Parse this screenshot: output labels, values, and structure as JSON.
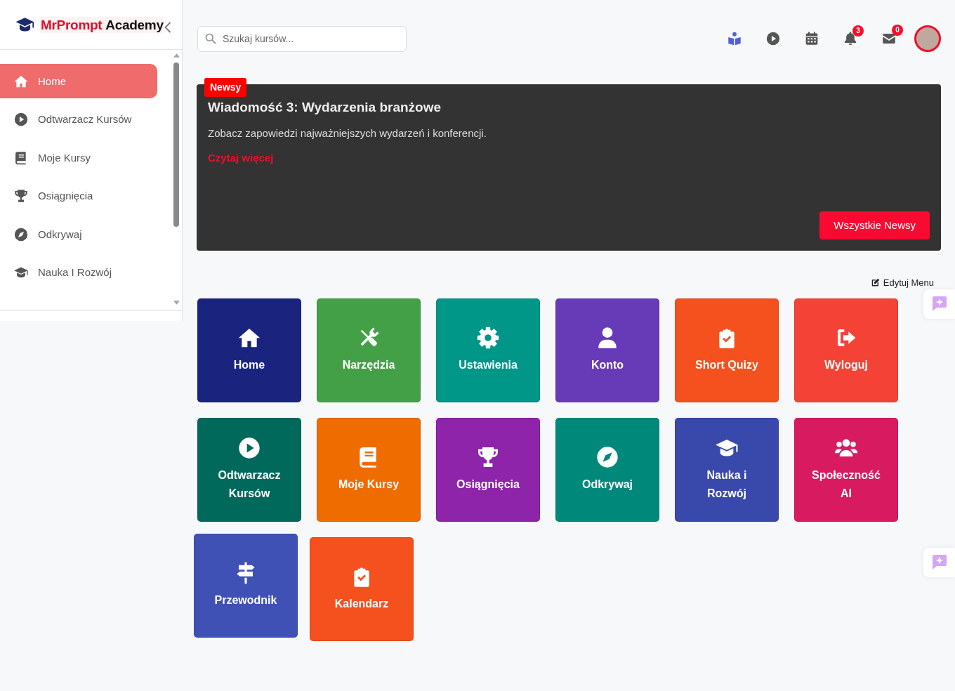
{
  "sidebar": {
    "logo": {
      "brand": "MrPrompt",
      "suffix": "Academy"
    },
    "items": [
      {
        "label": "Home",
        "selected": true
      },
      {
        "label": "Odtwarzacz Kursów",
        "selected": false
      },
      {
        "label": "Moje Kursy",
        "selected": false
      },
      {
        "label": "Osiągnięcia",
        "selected": false
      },
      {
        "label": "Odkrywaj",
        "selected": false
      },
      {
        "label": "Nauka I Rozwój",
        "selected": false
      }
    ]
  },
  "header": {
    "search": {
      "placeholder": "Szukaj kursów..."
    },
    "notifications_badge": "3",
    "messages_badge": "0"
  },
  "news": {
    "badge": "Newsy",
    "title": "Wiadomość 3: Wydarzenia branżowe",
    "text": "Zobacz zapowiedzi najważniejszych wydarzeń i konferencji.",
    "link": "Czytaj więcej",
    "button": "Wszystkie Newsy"
  },
  "edit_menu": "Edytuj Menu",
  "tiles": [
    {
      "label": "Home",
      "color": "#1a237e"
    },
    {
      "label": "Narzędzia",
      "color": "#43a047"
    },
    {
      "label": "Ustawienia",
      "color": "#009688"
    },
    {
      "label": "Konto",
      "color": "#673ab7"
    },
    {
      "label": "Short Quizy",
      "color": "#f4511e"
    },
    {
      "label": "Wyloguj",
      "color": "#f44336"
    },
    {
      "label": "Odtwarzacz Kursów",
      "color": "#00695c"
    },
    {
      "label": "Moje Kursy",
      "color": "#ef6c00"
    },
    {
      "label": "Osiągnięcia",
      "color": "#8e24aa"
    },
    {
      "label": "Odkrywaj",
      "color": "#00897b"
    },
    {
      "label": "Nauka i Rozwój",
      "color": "#3949ab"
    },
    {
      "label": "Społeczność AI",
      "color": "#d81b60"
    },
    {
      "label": "Przewodnik",
      "color": "#3f51b5"
    },
    {
      "label": "Kalendarz",
      "color": "#f4511e"
    }
  ]
}
